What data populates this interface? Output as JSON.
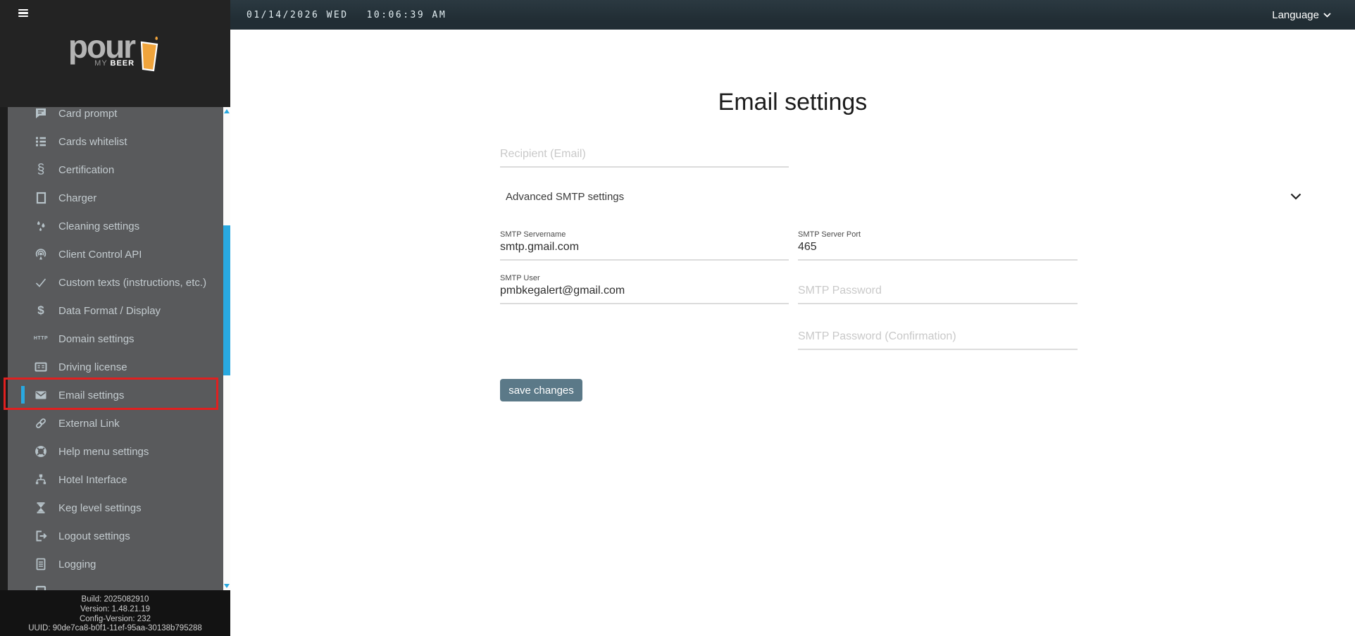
{
  "topbar": {
    "date": "01/14/2026 WED",
    "time": "10:06:39 AM",
    "language_label": "Language"
  },
  "sidebar": {
    "logo": {
      "word": "pour",
      "sub_my": "MY",
      "sub_beer": "BEER"
    },
    "items": [
      {
        "label": "Card prompt",
        "icon": "card-prompt-icon"
      },
      {
        "label": "Cards whitelist",
        "icon": "cards-whitelist-icon"
      },
      {
        "label": "Certification",
        "icon": "certification-icon"
      },
      {
        "label": "Charger",
        "icon": "charger-icon"
      },
      {
        "label": "Cleaning settings",
        "icon": "cleaning-icon"
      },
      {
        "label": "Client Control API",
        "icon": "client-control-api-icon"
      },
      {
        "label": "Custom texts (instructions, etc.)",
        "icon": "custom-texts-icon"
      },
      {
        "label": "Data Format / Display",
        "icon": "data-format-icon"
      },
      {
        "label": "Domain settings",
        "icon": "domain-settings-icon"
      },
      {
        "label": "Driving license",
        "icon": "driving-license-icon"
      },
      {
        "label": "Email settings",
        "icon": "email-settings-icon",
        "active": true
      },
      {
        "label": "External Link",
        "icon": "external-link-icon"
      },
      {
        "label": "Help menu settings",
        "icon": "help-menu-icon"
      },
      {
        "label": "Hotel Interface",
        "icon": "hotel-interface-icon"
      },
      {
        "label": "Keg level settings",
        "icon": "keg-level-icon"
      },
      {
        "label": "Logout settings",
        "icon": "logout-icon"
      },
      {
        "label": "Logging",
        "icon": "logging-icon"
      },
      {
        "label": "",
        "icon": "partial-item-icon"
      }
    ],
    "footer": {
      "build": "Build: 2025082910",
      "version": "Version: 1.48.21.19",
      "config_version": "Config-Version: 232",
      "uuid": "UUID: 90de7ca8-b0f1-11ef-95aa-30138b795288"
    }
  },
  "main": {
    "title": "Email settings",
    "recipient": {
      "placeholder": "Recipient (Email)",
      "value": ""
    },
    "advanced_section_label": "Advanced SMTP settings",
    "fields": {
      "smtp_servername": {
        "label": "SMTP Servername",
        "value": "smtp.gmail.com"
      },
      "smtp_server_port": {
        "label": "SMTP Server Port",
        "value": "465"
      },
      "smtp_user": {
        "label": "SMTP User",
        "value": "pmbkegalert@gmail.com"
      },
      "smtp_password": {
        "placeholder": "SMTP Password",
        "value": ""
      },
      "smtp_password_confirmation": {
        "placeholder": "SMTP Password (Confirmation)",
        "value": ""
      }
    },
    "save_button_label": "save changes"
  },
  "colors": {
    "accent": "#29a9e1",
    "annotation": "#e02020",
    "button": "#5b7988",
    "topbar": "#212d34",
    "topbar_hi": "#2b3941",
    "sidebar": "#595a5c"
  }
}
